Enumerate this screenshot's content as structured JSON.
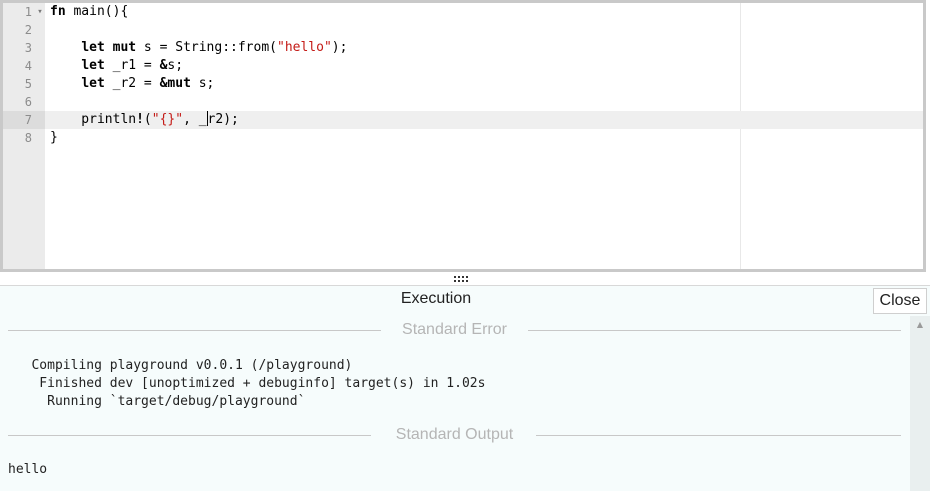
{
  "editor": {
    "lines": [
      {
        "num": "1",
        "fold": "▾",
        "tokens": [
          {
            "t": "fn",
            "c": "kw"
          },
          {
            "t": " main(){",
            "c": "plain"
          }
        ]
      },
      {
        "num": "2",
        "fold": "",
        "tokens": []
      },
      {
        "num": "3",
        "fold": "",
        "tokens": [
          {
            "t": "    ",
            "c": "plain"
          },
          {
            "t": "let mut",
            "c": "kw"
          },
          {
            "t": " s = String::from(",
            "c": "plain"
          },
          {
            "t": "\"hello\"",
            "c": "str"
          },
          {
            "t": ");",
            "c": "plain"
          }
        ]
      },
      {
        "num": "4",
        "fold": "",
        "tokens": [
          {
            "t": "    ",
            "c": "plain"
          },
          {
            "t": "let",
            "c": "kw"
          },
          {
            "t": " _r1 = ",
            "c": "plain"
          },
          {
            "t": "&",
            "c": "kw"
          },
          {
            "t": "s;",
            "c": "plain"
          }
        ]
      },
      {
        "num": "5",
        "fold": "",
        "tokens": [
          {
            "t": "    ",
            "c": "plain"
          },
          {
            "t": "let",
            "c": "kw"
          },
          {
            "t": " _r2 = ",
            "c": "plain"
          },
          {
            "t": "&mut",
            "c": "kw"
          },
          {
            "t": " s;",
            "c": "plain"
          }
        ]
      },
      {
        "num": "6",
        "fold": "",
        "tokens": []
      },
      {
        "num": "7",
        "fold": "",
        "active": true,
        "tokens": [
          {
            "t": "    println",
            "c": "plain"
          },
          {
            "t": "!",
            "c": "kw"
          },
          {
            "t": "(",
            "c": "plain"
          },
          {
            "t": "\"{}\"",
            "c": "str"
          },
          {
            "t": ", _",
            "c": "plain"
          },
          {
            "t": "",
            "c": "cursor"
          },
          {
            "t": "r2);",
            "c": "plain"
          }
        ]
      },
      {
        "num": "8",
        "fold": "",
        "tokens": [
          {
            "t": "}",
            "c": "plain"
          }
        ]
      }
    ]
  },
  "output": {
    "title": "Execution",
    "close_label": "Close",
    "stderr_label": "Standard Error",
    "stderr_lines": [
      "   Compiling playground v0.0.1 (/playground)",
      "    Finished dev [unoptimized + debuginfo] target(s) in 1.02s",
      "     Running `target/debug/playground`"
    ],
    "stdout_label": "Standard Output",
    "stdout_lines": [
      "hello"
    ]
  }
}
